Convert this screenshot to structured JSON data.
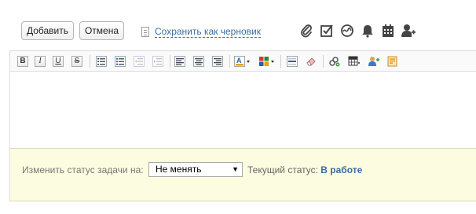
{
  "toolbar": {
    "add_label": "Добавить",
    "cancel_label": "Отмена",
    "draft_label": "Сохранить как черновик"
  },
  "top_icons": [
    "paperclip-icon",
    "checkbox-icon",
    "signature-icon",
    "bell-icon",
    "calendar-icon",
    "add-user-icon"
  ],
  "format_toolbar": {
    "bold": "B",
    "italic": "I",
    "underline": "U",
    "strike": "S"
  },
  "status_panel": {
    "change_label": "Изменить статус задачи на:",
    "selected_value": "Не менять",
    "current_label": "Текущий статус:",
    "current_value": "В работе"
  },
  "colors": {
    "link": "#3a6e9f",
    "status_bg": "#fcfce0"
  }
}
